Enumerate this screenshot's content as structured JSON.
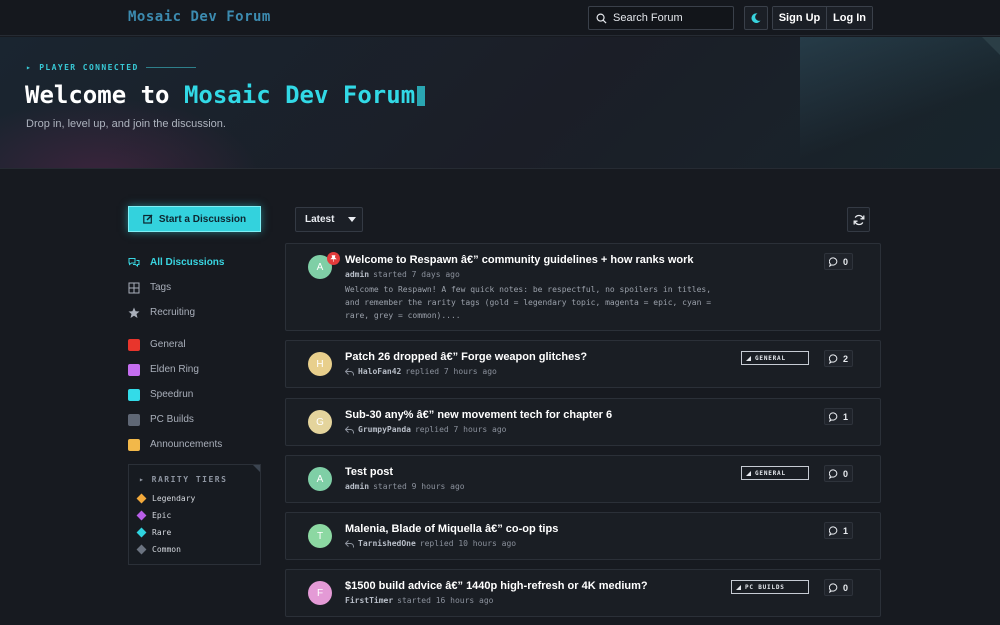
{
  "header": {
    "brand": "Mosaic Dev Forum",
    "search_placeholder": "Search Forum",
    "theme_icon": "moon-icon",
    "signup_label": "Sign Up",
    "login_label": "Log In"
  },
  "hero": {
    "kicker": "PLAYER CONNECTED",
    "title_prefix": "Welcome to ",
    "title_accent": "Mosaic Dev Forum",
    "subtitle": "Drop in, level up, and join the discussion."
  },
  "sidebar": {
    "start_label": "Start a Discussion",
    "nav": [
      {
        "label": "All Discussions",
        "icon": "chat-bubbles-icon",
        "active": true
      },
      {
        "label": "Tags",
        "icon": "grid-icon",
        "active": false
      },
      {
        "label": "Recruiting",
        "icon": "star-icon",
        "active": false
      }
    ],
    "tags": [
      {
        "label": "General",
        "color": "#e8352c"
      },
      {
        "label": "Elden Ring",
        "color": "#c56ef0"
      },
      {
        "label": "Speedrun",
        "color": "#33dbe8"
      },
      {
        "label": "PC Builds",
        "color": "#5f6775"
      },
      {
        "label": "Announcements",
        "color": "#f2b84a"
      }
    ],
    "rarity": {
      "title": "RARITY TIERS",
      "items": [
        {
          "label": "Legendary",
          "color": "#f2a93b"
        },
        {
          "label": "Epic",
          "color": "#b85ee8"
        },
        {
          "label": "Rare",
          "color": "#2fd3df"
        },
        {
          "label": "Common",
          "color": "#6b7380"
        }
      ]
    }
  },
  "main": {
    "sort_label": "Latest",
    "refresh_icon": "refresh-icon",
    "threads": [
      {
        "initial": "A",
        "avatar_color": "#7fcfa6",
        "pinned": true,
        "title": "Welcome to Respawn â€” community guidelines + how ranks work",
        "meta_user": "admin",
        "meta_text": "started 7 days ago",
        "replied": false,
        "excerpt": "Welcome to Respawn! A few quick notes: be respectful, no spoilers in titles, and remember the rarity tags (gold = legendary topic, magenta = epic, cyan = rare, grey = common)....",
        "tag": "",
        "replies": "0"
      },
      {
        "initial": "H",
        "avatar_color": "#e8cf8c",
        "pinned": false,
        "title": "Patch 26 dropped â€” Forge weapon glitches?",
        "meta_user": "HaloFan42",
        "meta_text": "replied 7 hours ago",
        "replied": true,
        "excerpt": "",
        "tag": "GENERAL",
        "replies": "2"
      },
      {
        "initial": "G",
        "avatar_color": "#e4d49c",
        "pinned": false,
        "title": "Sub-30 any% â€” new movement tech for chapter 6",
        "meta_user": "GrumpyPanda",
        "meta_text": "replied 7 hours ago",
        "replied": true,
        "excerpt": "",
        "tag": "",
        "replies": "1"
      },
      {
        "initial": "A",
        "avatar_color": "#7fcfa6",
        "pinned": false,
        "title": "Test post",
        "meta_user": "admin",
        "meta_text": "started 9 hours ago",
        "replied": false,
        "excerpt": "",
        "tag": "GENERAL",
        "replies": "0"
      },
      {
        "initial": "T",
        "avatar_color": "#8cd8a2",
        "pinned": false,
        "title": "Malenia, Blade of Miquella â€” co-op tips",
        "meta_user": "TarnishedOne",
        "meta_text": "replied 10 hours ago",
        "replied": true,
        "excerpt": "",
        "tag": "",
        "replies": "1"
      },
      {
        "initial": "F",
        "avatar_color": "#e49ad6",
        "pinned": false,
        "title": "$1500 build advice â€” 1440p high-refresh or 4K medium?",
        "meta_user": "FirstTimer",
        "meta_text": "started 16 hours ago",
        "replied": false,
        "excerpt": "",
        "tag": "PC BUILDS",
        "replies": "0"
      }
    ]
  }
}
